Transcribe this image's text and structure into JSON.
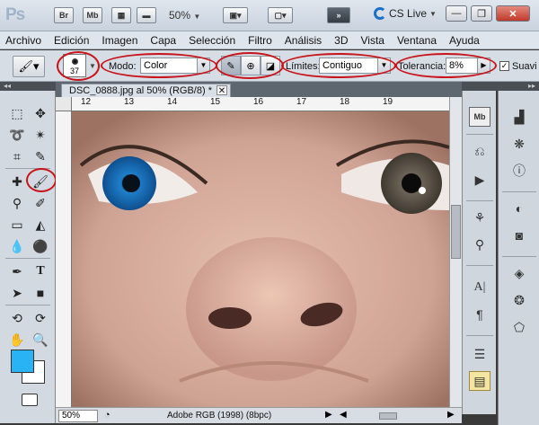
{
  "appbar": {
    "logo": "Ps",
    "bridge_btn": "Br",
    "minibridge_btn": "Mb",
    "zoom": "50%",
    "cs_live": "CS Live"
  },
  "menu": [
    "Archivo",
    "Edición",
    "Imagen",
    "Capa",
    "Selección",
    "Filtro",
    "Análisis",
    "3D",
    "Vista",
    "Ventana",
    "Ayuda"
  ],
  "options": {
    "brush_size": "37",
    "mode_label": "Modo:",
    "mode_value": "Color",
    "limits_label": "Límites:",
    "limits_value": "Contiguo",
    "tolerance_label": "Tolerancia:",
    "tolerance_value": "8%",
    "suavizar_label": "Suavi",
    "suavizar_checked": true
  },
  "document": {
    "tab_title": "DSC_0888.jpg al 50% (RGB/8) *",
    "close_glyph": "✕",
    "ruler_labels": [
      "12",
      "13",
      "14",
      "15",
      "16",
      "17",
      "18",
      "19"
    ]
  },
  "status": {
    "zoom": "50%",
    "profile": "Adobe RGB (1998) (8bpc)"
  },
  "colors": {
    "foreground": "#29b3f5",
    "background": "#ffffff",
    "highlight_ring": "#c8141b"
  }
}
